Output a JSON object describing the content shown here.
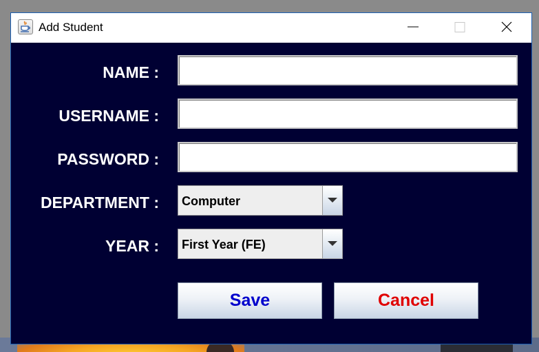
{
  "window": {
    "title": "Add Student",
    "icon": "java-cup-icon"
  },
  "form": {
    "name_label": "NAME :",
    "name_value": "",
    "username_label": "USERNAME :",
    "username_value": "",
    "password_label": "PASSWORD :",
    "password_value": "",
    "department_label": "DEPARTMENT :",
    "department_value": "Computer",
    "year_label": "YEAR :",
    "year_value": "First Year (FE)"
  },
  "buttons": {
    "save_label": "Save",
    "cancel_label": "Cancel"
  },
  "colors": {
    "panel_background": "#000033",
    "save_text": "#0000cc",
    "cancel_text": "#e00000"
  }
}
